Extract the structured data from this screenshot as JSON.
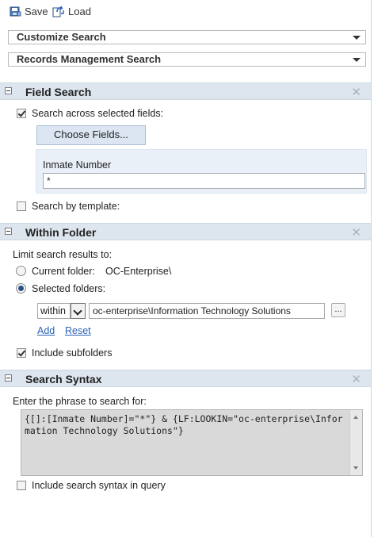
{
  "toolbar": {
    "save_label": "Save",
    "load_label": "Load",
    "save_icon": "save-disk-icon",
    "load_icon": "load-arrows-icon"
  },
  "dropdowns": [
    {
      "label": "Customize Search"
    },
    {
      "label": "Records Management Search"
    }
  ],
  "field_search": {
    "title": "Field Search",
    "across_fields_label": "Search across selected fields:",
    "across_fields_checked": true,
    "choose_fields_label": "Choose Fields...",
    "field_name": "Inmate Number",
    "field_value": "*",
    "by_template_label": "Search by template:",
    "by_template_checked": false
  },
  "within_folder": {
    "title": "Within Folder",
    "limit_label": "Limit search results to:",
    "current_folder_label": "Current folder:",
    "current_folder_value": "OC-Enterprise\\",
    "selected_folders_label": "Selected folders:",
    "selected_option": "selected",
    "within_value": "within",
    "folder_path": "oc-enterprise\\Information Technology Solutions",
    "browse_label": "...",
    "add_label": "Add",
    "reset_label": "Reset",
    "include_subfolders_label": "Include subfolders",
    "include_subfolders_checked": true
  },
  "search_syntax": {
    "title": "Search Syntax",
    "prompt": "Enter the phrase to search for:",
    "query": "{[]:[Inmate Number]=\"*\"} & {LF:LOOKIN=\"oc-enterprise\\Information Technology Solutions\"}",
    "include_label": "Include search syntax in query",
    "include_checked": false
  },
  "close_glyph": "✕",
  "colors": {
    "section_header_bg": "#dde6ee",
    "link": "#2b63b5",
    "button_bg": "#dbe6f2"
  }
}
